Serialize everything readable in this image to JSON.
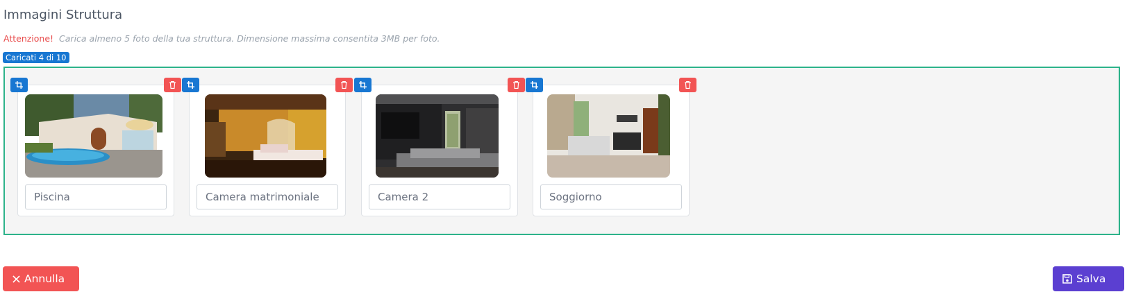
{
  "header": {
    "title": "Immagini Struttura"
  },
  "notice": {
    "warning": "Attenzione!",
    "message": "Carica almeno 5 foto della tua struttura. Dimensione massima consentita 3MB per foto."
  },
  "counter": {
    "label": "Caricati 4 di 10"
  },
  "images": [
    {
      "name": "Piscina",
      "alt": "pool-photo"
    },
    {
      "name": "Camera matrimoniale",
      "alt": "double-bedroom-photo"
    },
    {
      "name": "Camera 2",
      "alt": "bedroom-photo"
    },
    {
      "name": "Soggiorno",
      "alt": "living-room-photo"
    }
  ],
  "actions": {
    "cancel_label": "Annulla",
    "save_label": "Salva"
  },
  "colors": {
    "primary": "#1877d2",
    "danger": "#f25454",
    "success_border": "#2db38a",
    "save": "#5b3fd1"
  },
  "icons": {
    "crop": "crop-icon",
    "delete": "trash-icon",
    "close": "x-icon",
    "save": "floppy-disk-icon"
  }
}
